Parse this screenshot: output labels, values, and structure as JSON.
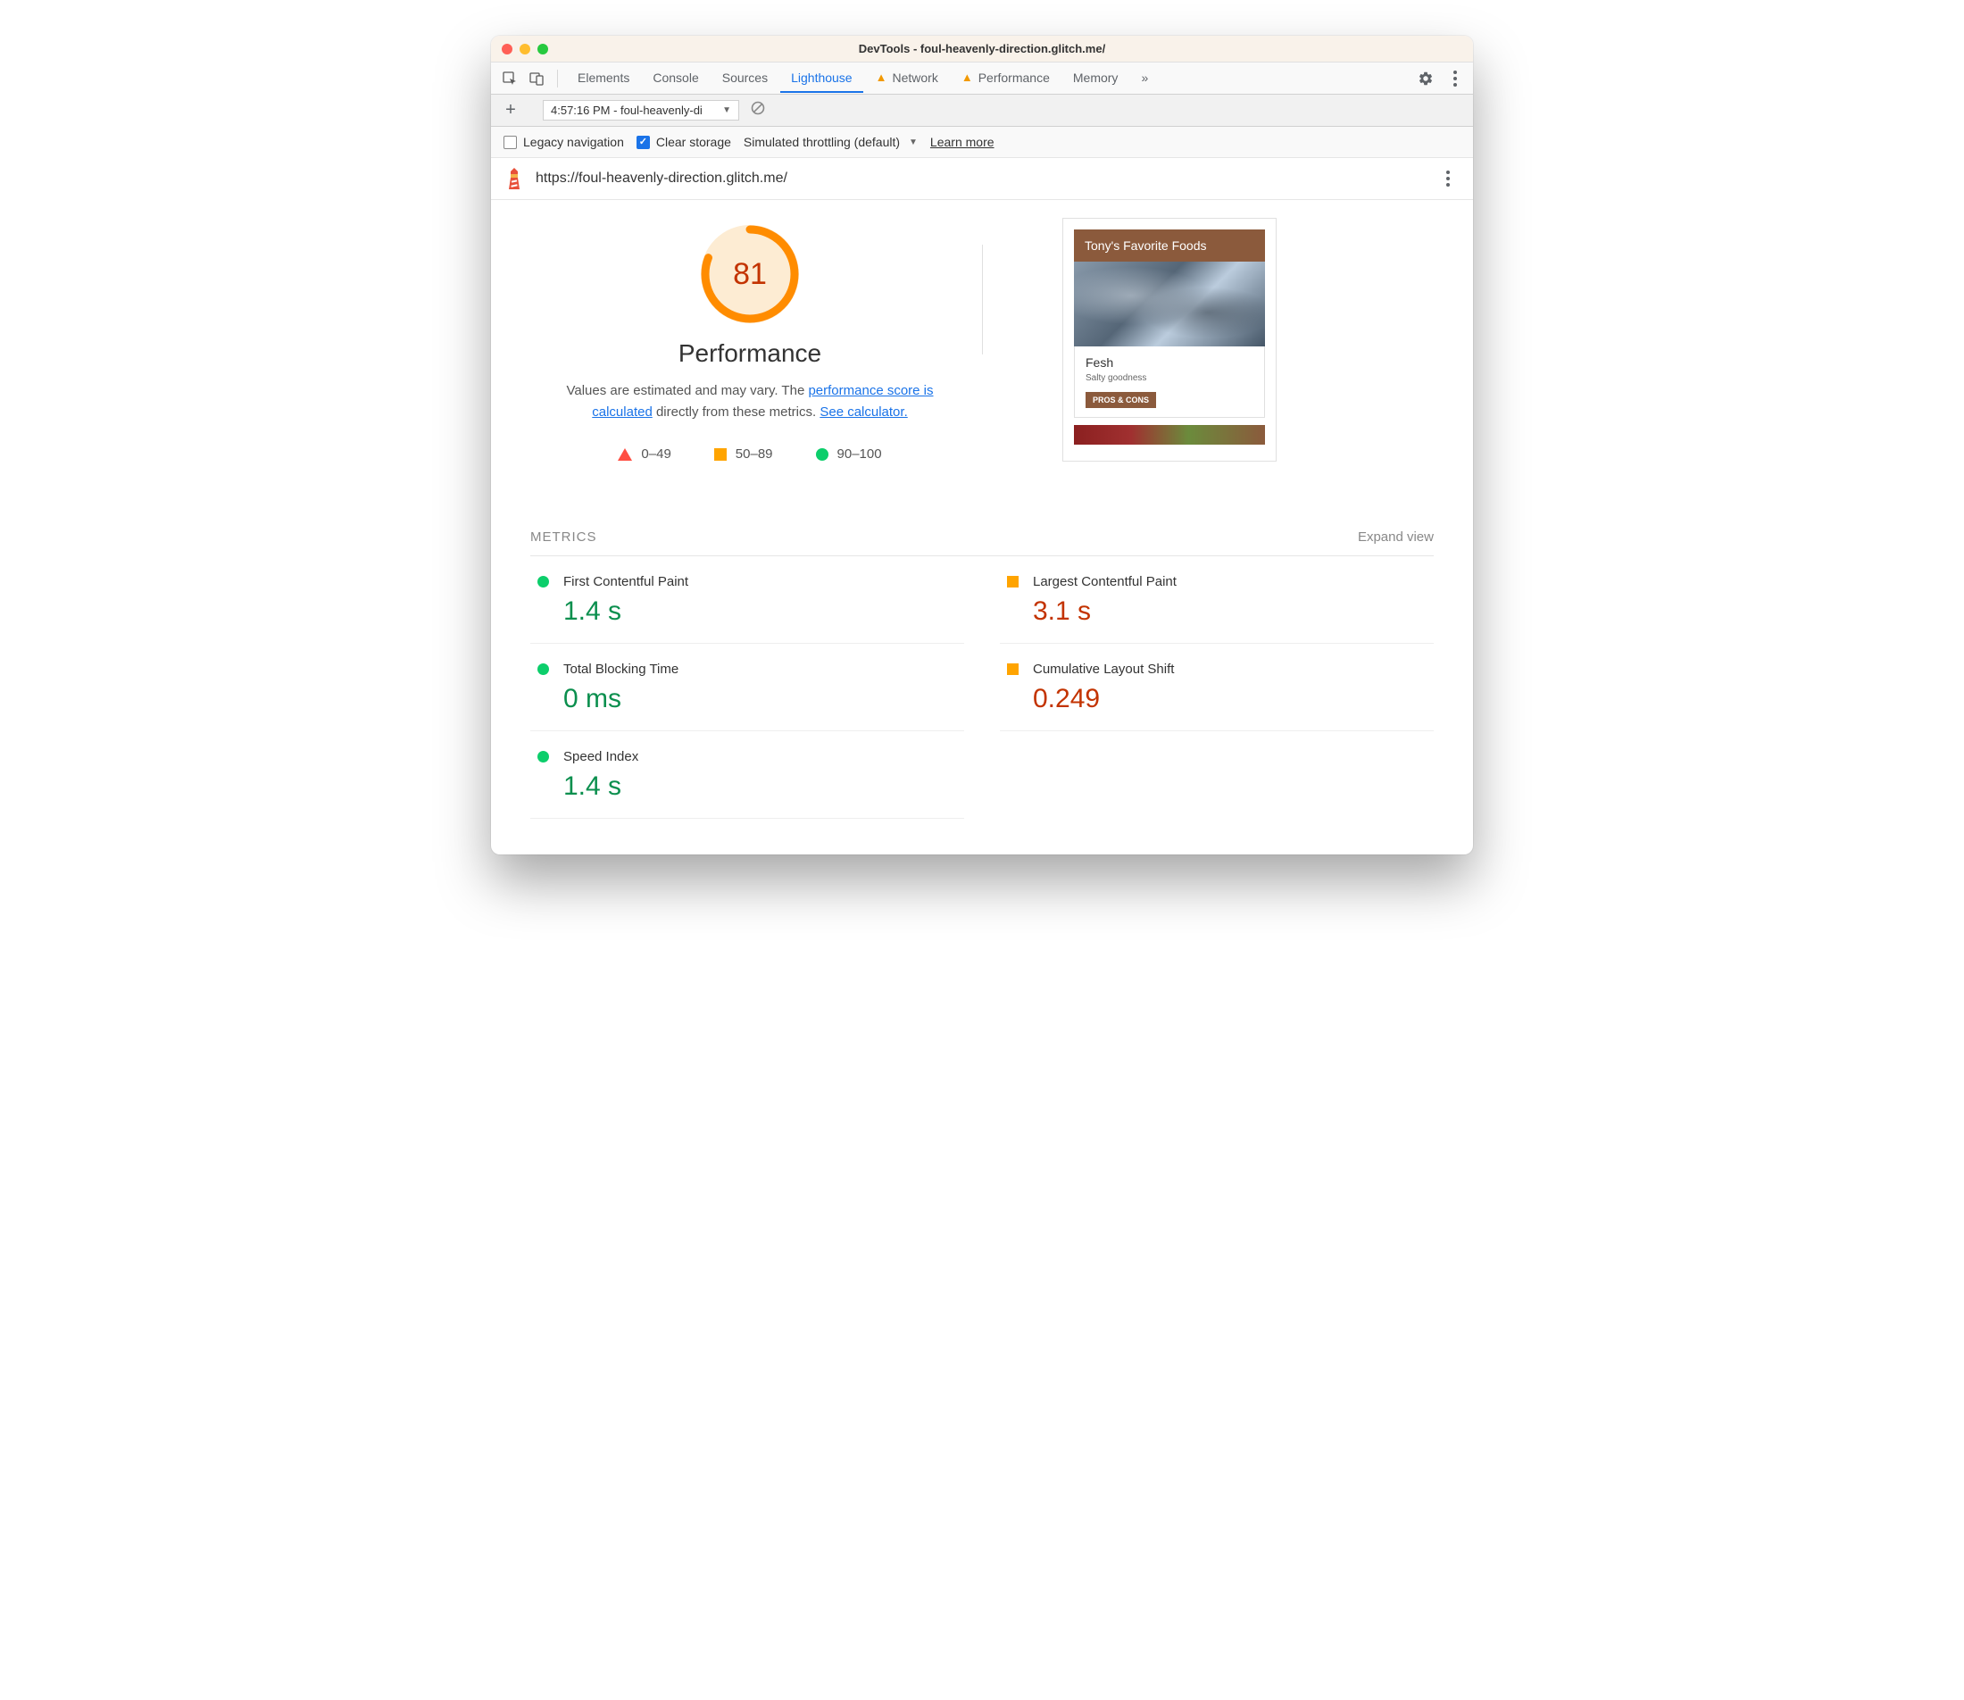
{
  "window": {
    "title": "DevTools - foul-heavenly-direction.glitch.me/"
  },
  "tabs": {
    "items": [
      "Elements",
      "Console",
      "Sources",
      "Lighthouse",
      "Network",
      "Performance",
      "Memory"
    ],
    "active": "Lighthouse",
    "warn_tabs": [
      "Network",
      "Performance"
    ]
  },
  "subbar": {
    "report_label": "4:57:16 PM - foul-heavenly-di"
  },
  "optionsbar": {
    "legacy_label": "Legacy navigation",
    "clear_label": "Clear storage",
    "throttle_label": "Simulated throttling (default)",
    "learn_label": "Learn more"
  },
  "report": {
    "url": "https://foul-heavenly-direction.glitch.me/",
    "score": "81",
    "category": "Performance",
    "desc_pre": "Values are estimated and may vary. The ",
    "desc_link1": "performance score is calculated",
    "desc_mid": " directly from these metrics. ",
    "desc_link2": "See calculator.",
    "legend": {
      "fail": "0–49",
      "avg": "50–89",
      "pass": "90–100"
    }
  },
  "thumbnail": {
    "header": "Tony's Favorite Foods",
    "card_title": "Fesh",
    "card_sub": "Salty goodness",
    "card_btn": "PROS & CONS"
  },
  "metrics": {
    "heading": "METRICS",
    "expand": "Expand view",
    "items": [
      {
        "name": "First Contentful Paint",
        "value": "1.4 s",
        "status": "pass"
      },
      {
        "name": "Largest Contentful Paint",
        "value": "3.1 s",
        "status": "avg"
      },
      {
        "name": "Total Blocking Time",
        "value": "0 ms",
        "status": "pass"
      },
      {
        "name": "Cumulative Layout Shift",
        "value": "0.249",
        "status": "avg"
      },
      {
        "name": "Speed Index",
        "value": "1.4 s",
        "status": "pass"
      }
    ]
  }
}
